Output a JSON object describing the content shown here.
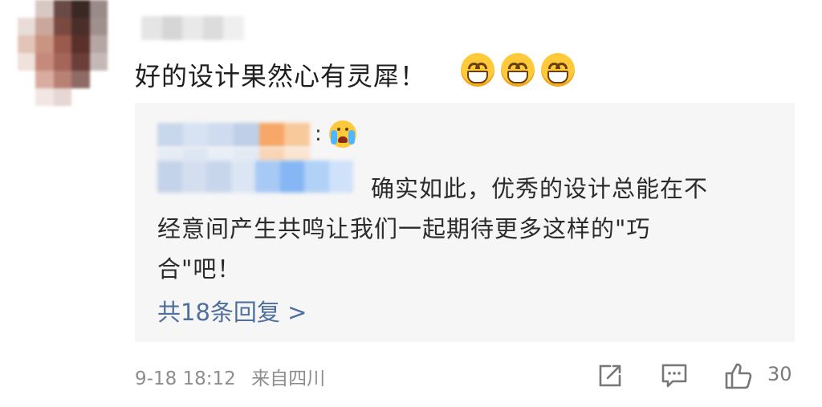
{
  "comment": {
    "text": "好的设计果然心有灵犀！",
    "emojis": [
      "grinning-face",
      "grinning-face",
      "grinning-face"
    ]
  },
  "reply": {
    "colon": ":",
    "emoji": "crying-face",
    "line1": "确实如此，优秀的设计总能在不",
    "line2": "经意间产生共鸣让我们一起期待更多这样的\"巧",
    "line3": "合\"吧！",
    "more_replies": "共18条回复 >"
  },
  "meta": {
    "date_time": "9-18 18:12",
    "location": "来自四川",
    "like_count": "30"
  },
  "colors": {
    "panel_bg": "#f6f6f6",
    "link_blue": "#4f6f9f",
    "meta_gray": "#8d8d8d"
  },
  "icons": [
    "share-icon",
    "comment-icon",
    "thumbs-up-icon"
  ]
}
